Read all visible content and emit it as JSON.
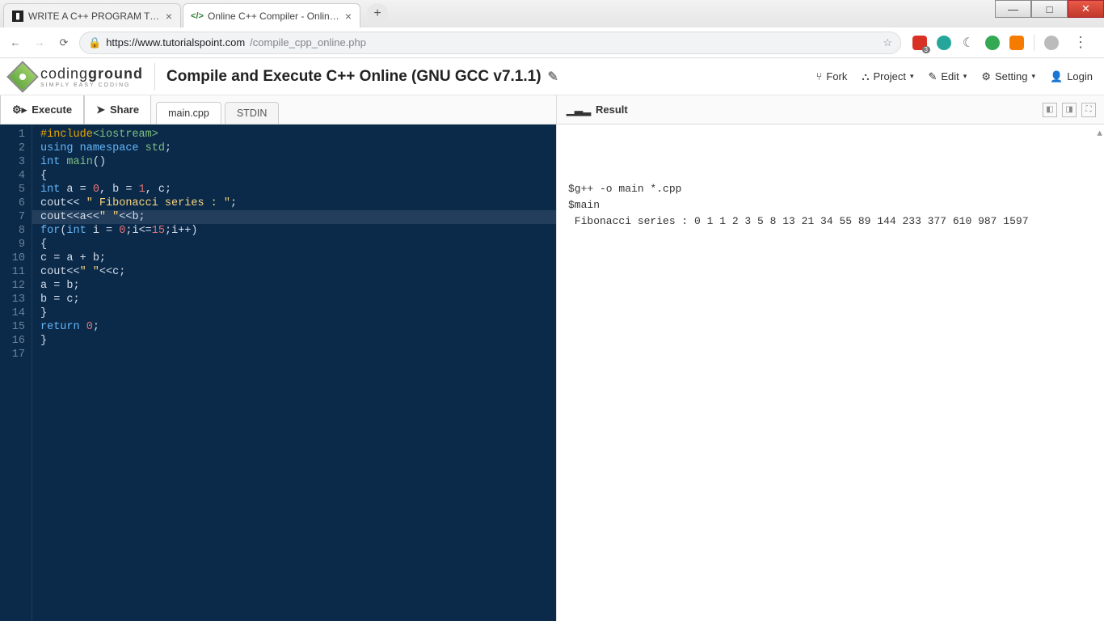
{
  "browser": {
    "tabs": [
      {
        "title": "WRITE A C++ PROGRAM TO GE",
        "favicon": "▮"
      },
      {
        "title": "Online C++ Compiler - Online C",
        "favicon": "</>"
      }
    ],
    "active_tab_index": 1,
    "url_host": "https://www.tutorialspoint.com",
    "url_path": "/compile_cpp_online.php",
    "ext_badge": "3"
  },
  "site": {
    "logo_line1_light": "coding",
    "logo_line1_bold": "ground",
    "logo_line2": "SIMPLY EASY CODING",
    "page_title": "Compile and Execute C++ Online (GNU GCC v7.1.1)",
    "menu": {
      "fork": "Fork",
      "project": "Project",
      "edit": "Edit",
      "setting": "Setting",
      "login": "Login"
    }
  },
  "actions": {
    "execute": "Execute",
    "share": "Share",
    "file_tabs": [
      "main.cpp",
      "STDIN"
    ],
    "active_file_index": 0,
    "result_label": "Result"
  },
  "code_lines": [
    {
      "n": 1,
      "html": "<span class='pp'>#include</span><span class='inc'>&lt;iostream&gt;</span>"
    },
    {
      "n": 2,
      "html": "<span class='kw'>using</span> <span class='kw'>namespace</span> <span class='inc'>std</span>;"
    },
    {
      "n": 3,
      "html": "<span class='kw'>int</span> <span class='inc'>main</span>()"
    },
    {
      "n": 4,
      "html": "{"
    },
    {
      "n": 5,
      "html": "<span class='kw'>int</span> a <span class='op'>=</span> <span class='num'>0</span>, b <span class='op'>=</span> <span class='num'>1</span>, c;"
    },
    {
      "n": 6,
      "html": "cout<span class='op'>&lt;&lt;</span> <span class='str'>&quot; Fibonacci series : &quot;</span>;"
    },
    {
      "n": 7,
      "html": "cout<span class='op'>&lt;&lt;</span>a<span class='op'>&lt;&lt;</span><span class='str'>&quot; &quot;</span><span class='op'>&lt;&lt;</span>b;",
      "highlight": true
    },
    {
      "n": 8,
      "html": "<span class='kw'>for</span>(<span class='kw'>int</span> i <span class='op'>=</span> <span class='num'>0</span>;i<span class='op'>&lt;=</span><span class='num'>15</span>;i<span class='op'>++</span>)"
    },
    {
      "n": 9,
      "html": "{"
    },
    {
      "n": 10,
      "html": "c <span class='op'>=</span> a <span class='op'>+</span> b;"
    },
    {
      "n": 11,
      "html": "cout<span class='op'>&lt;&lt;</span><span class='str'>&quot; &quot;</span><span class='op'>&lt;&lt;</span>c;"
    },
    {
      "n": 12,
      "html": "a <span class='op'>=</span> b;"
    },
    {
      "n": 13,
      "html": "b <span class='op'>=</span> c;"
    },
    {
      "n": 14,
      "html": "}"
    },
    {
      "n": 15,
      "html": "<span class='kw'>return</span> <span class='num'>0</span>;"
    },
    {
      "n": 16,
      "html": "}"
    },
    {
      "n": 17,
      "html": ""
    }
  ],
  "result_lines": [
    "$g++ -o main *.cpp",
    "$main",
    " Fibonacci series : 0 1 1 2 3 5 8 13 21 34 55 89 144 233 377 610 987 1597"
  ]
}
